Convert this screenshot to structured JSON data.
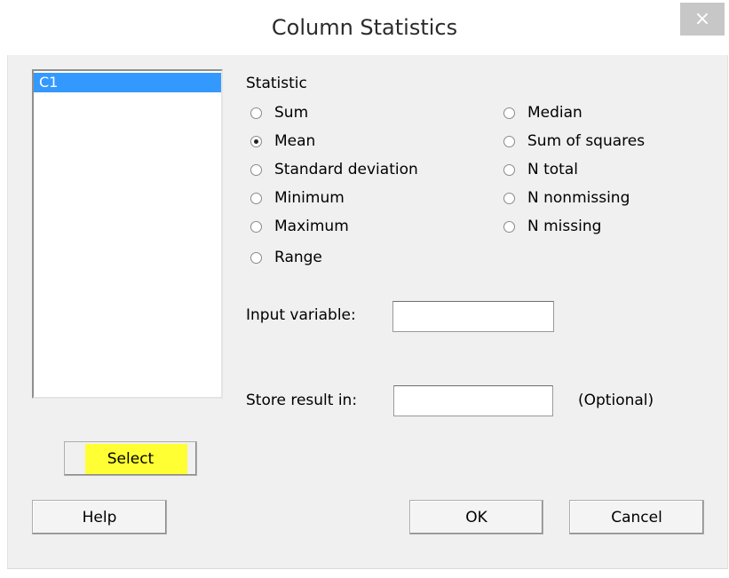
{
  "window": {
    "title": "Column Statistics",
    "close_glyph": "×"
  },
  "variables": [
    "C1"
  ],
  "statistic": {
    "heading": "Statistic",
    "left_options": [
      "Sum",
      "Mean",
      "Standard deviation",
      "Minimum",
      "Maximum",
      "Range"
    ],
    "right_options": [
      "Median",
      "Sum of squares",
      "N total",
      "N nonmissing",
      "N missing"
    ],
    "selected": "Mean"
  },
  "input_variable": {
    "label": "Input variable:",
    "value": ""
  },
  "store_result": {
    "label": "Store result in:",
    "value": "",
    "note": "(Optional)"
  },
  "buttons": {
    "select": "Select",
    "help": "Help",
    "ok": "OK",
    "cancel": "Cancel"
  },
  "colors": {
    "selection": "#3399ff",
    "highlight": "#ffff33"
  }
}
